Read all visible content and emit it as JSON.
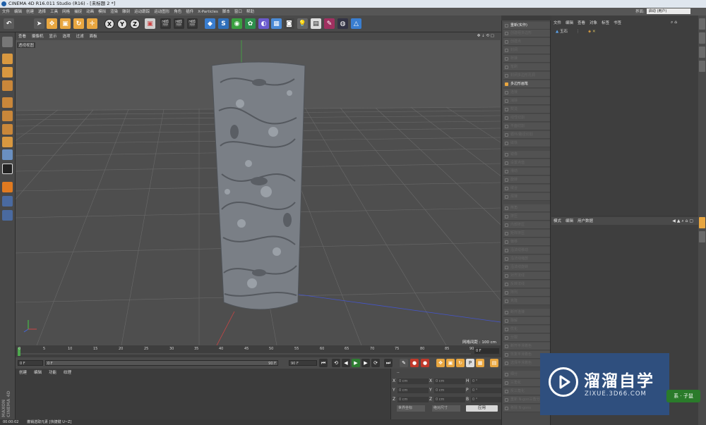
{
  "title_bar": {
    "text": "CINEMA 4D R16.011 Studio (R16) - [未标题 2 *]"
  },
  "menu": [
    "文件",
    "编辑",
    "创建",
    "选择",
    "工具",
    "网格",
    "捕捉",
    "动画",
    "模拟",
    "渲染",
    "雕刻",
    "运动跟踪",
    "运动图形",
    "角色",
    "插件",
    "X-Particles",
    "脚本",
    "窗口",
    "帮助"
  ],
  "layout": {
    "label": "界面:",
    "value": "启动 (用户)"
  },
  "viewport": {
    "menu": [
      "查看",
      "摄像机",
      "显示",
      "选项",
      "过滤",
      "面板"
    ],
    "label": "透视视图",
    "grid_spacing": "网格间距 : 100 cm",
    "bg_color": "#565656",
    "floor_color": "#4e4e4e"
  },
  "timeline": {
    "ticks": [
      "0",
      "5",
      "10",
      "15",
      "20",
      "25",
      "30",
      "35",
      "40",
      "45",
      "50",
      "55",
      "60",
      "65",
      "70",
      "75",
      "80",
      "85",
      "90"
    ],
    "current_frame": "0 F",
    "start_field": "0 F",
    "range_start": "0 F",
    "range_end": "90 F",
    "end_field": "90 F"
  },
  "material_panel": {
    "tabs": [
      "创建",
      "编辑",
      "功能",
      "纹理"
    ]
  },
  "coordinates": {
    "header": "--",
    "rows": [
      {
        "axis": "X",
        "pos": "0 cm",
        "size": "0 cm",
        "rot_label": "H",
        "rot": "0 °"
      },
      {
        "axis": "Y",
        "pos": "0 cm",
        "size": "0 cm",
        "rot_label": "P",
        "rot": "0 °"
      },
      {
        "axis": "Z",
        "pos": "0 cm",
        "size": "0 cm",
        "rot_label": "B",
        "rot": "0 °"
      }
    ],
    "mode": "世界坐标",
    "scale_mode": "绝对尺寸",
    "apply": "应用"
  },
  "status": {
    "time": "00:00:02",
    "message": "撤销选取元素 [快捷键 U~Z]"
  },
  "palette_items": [
    {
      "label": "重新(实作)",
      "on": true
    },
    {
      "label": "创建组多边形",
      "on": false
    },
    {
      "label": "创建点",
      "on": false
    },
    {
      "label": "封闭",
      "on": false
    },
    {
      "label": "桥接",
      "on": false
    },
    {
      "label": "笔刷",
      "on": false
    },
    {
      "label": "封闭多边形孔洞",
      "on": false
    },
    {
      "label": "多边形画笔",
      "on": true
    },
    {
      "label": "连接",
      "on": false
    },
    {
      "label": "消除",
      "on": false
    },
    {
      "label": "熨烫",
      "on": false
    },
    {
      "label": "线性切割",
      "on": false
    },
    {
      "label": "平面切割",
      "on": false
    },
    {
      "label": "循环/路径切割",
      "on": false
    },
    {
      "label": "磁铁",
      "on": false
    },
    {
      "label": "镜像",
      "on": false
    },
    {
      "label": "设置点值",
      "on": false
    },
    {
      "label": "滑动",
      "on": false
    },
    {
      "label": "旋转",
      "on": false
    },
    {
      "label": "缝合",
      "on": false
    },
    {
      "label": "焊接",
      "on": false
    },
    {
      "label": "倒角",
      "on": false
    },
    {
      "label": "挤压",
      "on": false
    },
    {
      "label": "内部挤压",
      "on": false
    },
    {
      "label": "矩阵挤压",
      "on": false
    },
    {
      "label": "偏移",
      "on": false
    },
    {
      "label": "沿法线移动",
      "on": false
    },
    {
      "label": "沿法线缩放",
      "on": false
    },
    {
      "label": "沿法线旋转",
      "on": false
    },
    {
      "label": "对齐法线",
      "on": false
    },
    {
      "label": "反转法线",
      "on": false
    },
    {
      "label": "阵列",
      "on": false
    },
    {
      "label": "克隆",
      "on": false
    },
    {
      "label": "断开连接",
      "on": false
    },
    {
      "label": "融解",
      "on": false
    },
    {
      "label": "优化",
      "on": false
    },
    {
      "label": "分裂",
      "on": false
    },
    {
      "label": "断开平滑着色",
      "on": false
    },
    {
      "label": "恢复平滑着色",
      "on": false
    },
    {
      "label": "选择平滑着色",
      "on": false
    },
    {
      "label": "细分",
      "on": false
    },
    {
      "label": "三角化",
      "on": false
    },
    {
      "label": "反三角化",
      "on": false
    },
    {
      "label": "重新 N-gon三角分布",
      "on": false
    },
    {
      "label": "移除 N-gons",
      "on": false
    }
  ],
  "object_manager": {
    "menu": [
      "文件",
      "编辑",
      "查看",
      "对象",
      "标签",
      "书签"
    ],
    "object_name": "玉石"
  },
  "attribute_manager": {
    "menu": [
      "模式",
      "编辑",
      "用户数据"
    ]
  },
  "watermark": {
    "name": "溜溜自学",
    "url": "ZIXUE.3D66.COM"
  },
  "corner_badge": "系 · 子鼠"
}
